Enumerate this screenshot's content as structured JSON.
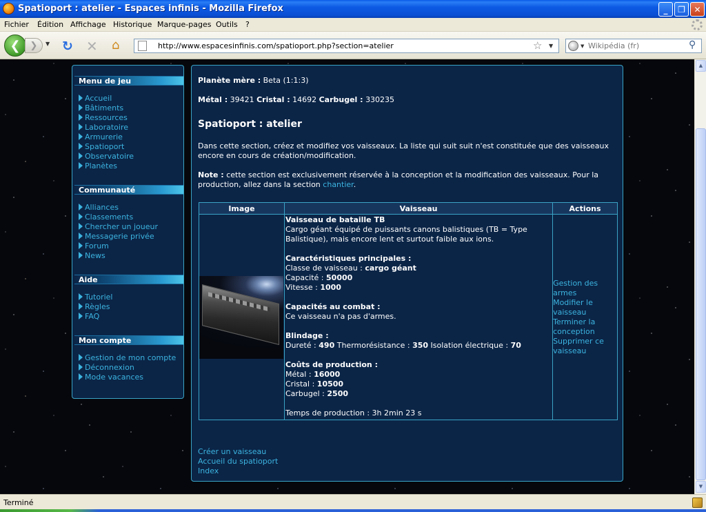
{
  "window": {
    "title": "Spatioport : atelier - Espaces infinis - Mozilla Firefox",
    "minimize_label": "_",
    "maximize_label": "❐",
    "close_label": "✕"
  },
  "menubar": {
    "items": [
      "Fichier",
      "Édition",
      "Affichage",
      "Historique",
      "Marque-pages",
      "Outils",
      "?"
    ]
  },
  "navbar": {
    "back_icon": "back-arrow-icon",
    "back_glyph": "❮",
    "forward_glyph": "❯",
    "dropdown_glyph": "▼",
    "reload_glyph": "↻",
    "stop_glyph": "✕",
    "home_glyph": "⌂",
    "url": "http://www.espacesinfinis.com/spatioport.php?section=atelier",
    "star_glyph": "☆",
    "search_placeholder": "Wikipédia (fr)",
    "search_glyph": "⚲"
  },
  "side_menu": {
    "sections": [
      {
        "title": "Menu de jeu",
        "items": [
          "Accueil",
          "Bâtiments",
          "Ressources",
          "Laboratoire",
          "Armurerie",
          "Spatioport",
          "Observatoire",
          "Planètes"
        ]
      },
      {
        "title": "Communauté",
        "items": [
          "Alliances",
          "Classements",
          "Chercher un joueur",
          "Messagerie privée",
          "Forum",
          "News"
        ]
      },
      {
        "title": "Aide",
        "items": [
          "Tutoriel",
          "Règles",
          "FAQ"
        ]
      },
      {
        "title": "Mon compte",
        "items": [
          "Gestion de mon compte",
          "Déconnexion",
          "Mode vacances"
        ]
      }
    ]
  },
  "main": {
    "planet_label": "Planète mère :",
    "planet_value": "Beta (1:1:3)",
    "resources": {
      "metal_label": "Métal :",
      "metal_value": "39421",
      "cristal_label": "Cristal :",
      "cristal_value": "14692",
      "carbugel_label": "Carbugel :",
      "carbugel_value": "330235"
    },
    "title": "Spatioport : atelier",
    "intro": "Dans cette section, créez et modifiez vos vaisseaux. La liste qui suit suit n'est constituée que des vaisseaux encore en cours de création/modification.",
    "note_label": "Note :",
    "note_text": "cette section est exclusivement réservée à la conception et la modification des vaisseaux. Pour la production, allez dans la section",
    "note_link": "chantier",
    "note_end": ".",
    "table": {
      "headers": [
        "Image",
        "Vaisseau",
        "Actions"
      ],
      "rows": [
        {
          "name": "Vaisseau de bataille TB",
          "description": "Cargo géant équipé de puissants canons balistiques (TB = Type Balistique), mais encore lent et surtout faible aux ions.",
          "specs_title": "Caractéristiques principales :",
          "class_label": "Classe de vaisseau :",
          "class_value": "cargo géant",
          "capacity_label": "Capacité :",
          "capacity_value": "50000",
          "speed_label": "Vitesse :",
          "speed_value": "1000",
          "combat_title": "Capacités au combat :",
          "combat_text": "Ce vaisseau n'a pas d'armes.",
          "armor_title": "Blindage :",
          "durete_label": "Dureté :",
          "durete_value": "490",
          "thermo_label": "Thermorésistance :",
          "thermo_value": "350",
          "isolation_label": "Isolation électrique :",
          "isolation_value": "70",
          "costs_title": "Coûts de production :",
          "cost_metal_label": "Métal :",
          "cost_metal_value": "16000",
          "cost_cristal_label": "Cristal :",
          "cost_cristal_value": "10500",
          "cost_carbugel_label": "Carbugel :",
          "cost_carbugel_value": "2500",
          "time_text": "Temps de production : 3h 2min 23 s",
          "actions": [
            "Gestion des armes",
            "Modifier le vaisseau",
            "Terminer la conception",
            "Supprimer ce vaisseau"
          ]
        }
      ]
    },
    "bottom_links": [
      "Créer un vaisseau",
      "Accueil du spatioport",
      "Index"
    ]
  },
  "statusbar": {
    "text": "Terminé"
  }
}
